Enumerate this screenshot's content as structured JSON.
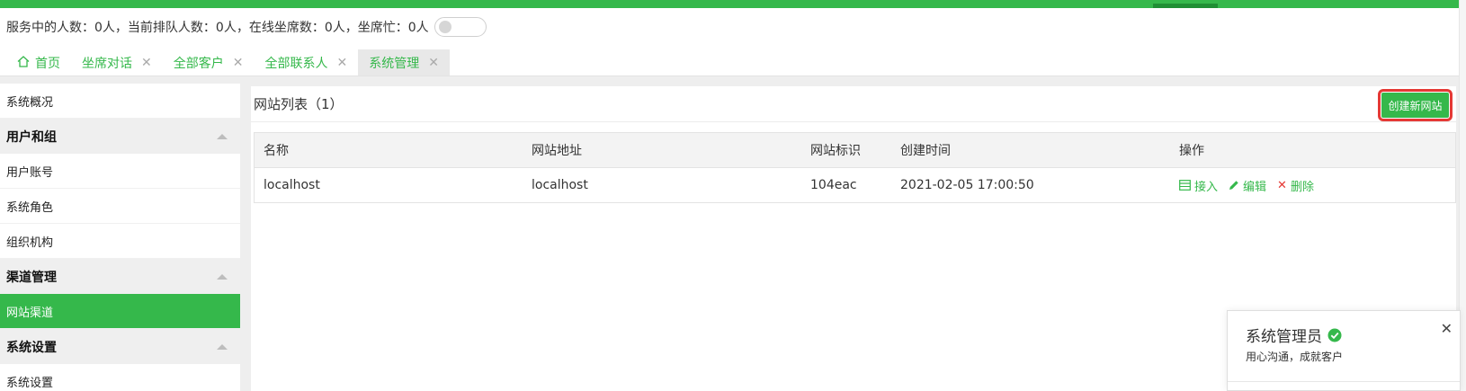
{
  "colors": {
    "accent": "#35b84b",
    "danger": "#e53935",
    "highlight": "#e53935"
  },
  "status": {
    "text": "服务中的人数：0人，当前排队人数：0人，在线坐席数：0人，坐席忙：0人",
    "busy_toggle_on": false
  },
  "tabs": [
    {
      "label": "首页",
      "icon": "home-icon",
      "closable": false
    },
    {
      "label": "坐席对话",
      "closable": true
    },
    {
      "label": "全部客户",
      "closable": true
    },
    {
      "label": "全部联系人",
      "closable": true
    },
    {
      "label": "系统管理",
      "closable": true,
      "active": true
    }
  ],
  "sidebar": {
    "overview": "系统概况",
    "groups": [
      {
        "title": "用户和组",
        "items": [
          "用户账号",
          "系统角色",
          "组织机构"
        ]
      },
      {
        "title": "渠道管理",
        "items": [
          "网站渠道"
        ]
      },
      {
        "title": "系统设置",
        "items": [
          "系统设置"
        ]
      }
    ],
    "active_item": "网站渠道"
  },
  "main": {
    "title": "网站列表（1）",
    "create_button": "创建新网站",
    "table": {
      "headers": [
        "名称",
        "网站地址",
        "网站标识",
        "创建时间",
        "操作"
      ],
      "rows": [
        {
          "name": "localhost",
          "url": "localhost",
          "id": "104eac",
          "created": "2021-02-05 17:00:50"
        }
      ],
      "actions": {
        "access": "接入",
        "edit": "编辑",
        "delete": "删除"
      }
    }
  },
  "card": {
    "name": "系统管理员",
    "slogan": "用心沟通，成就客户"
  }
}
